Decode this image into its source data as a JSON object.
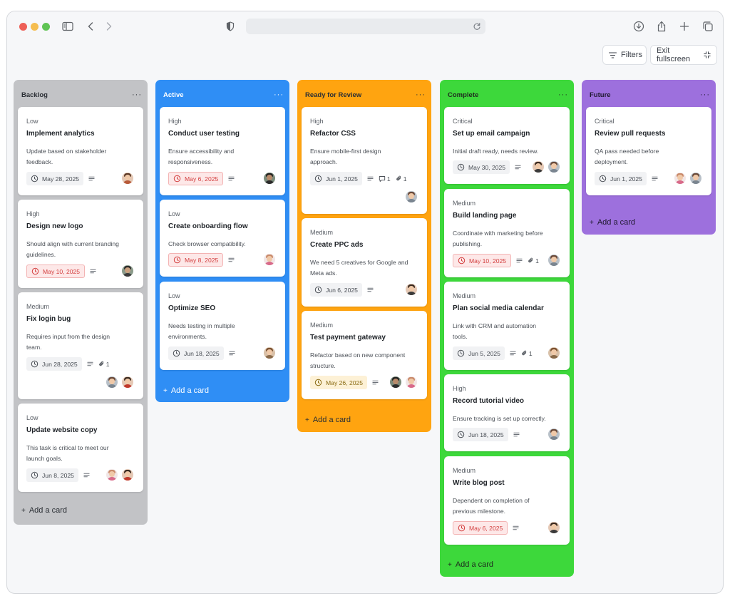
{
  "toolbar": {
    "filters_label": "Filters",
    "exit_fullscreen_label": "Exit fullscreen"
  },
  "add_card_label": "Add a card",
  "colors": {
    "backlog": "#c2c3c6",
    "active": "#2f8ef5",
    "ready_for_review": "#ffa410",
    "complete": "#3dd83b",
    "future": "#9d70dd"
  },
  "columns": [
    {
      "title": "Backlog",
      "cards": [
        {
          "priority": "Low",
          "title": "Implement analytics",
          "desc1": "Update based on stakeholder",
          "desc2": "feedback.",
          "date": "May 28, 2025"
        },
        {
          "priority": "High",
          "title": "Design new logo",
          "desc1": "Should align with current branding",
          "desc2": "guidelines.",
          "date": "May 10, 2025"
        },
        {
          "priority": "Medium",
          "title": "Fix login bug",
          "desc1": "Requires input from the design",
          "desc2": "team.",
          "date": "Jun 28, 2025",
          "attachments": "1"
        },
        {
          "priority": "Low",
          "title": "Update website copy",
          "desc1": "This task is critical to meet our",
          "desc2": "launch goals.",
          "date": "Jun 8, 2025"
        }
      ]
    },
    {
      "title": "Active",
      "cards": [
        {
          "priority": "High",
          "title": "Conduct user testing",
          "desc1": "Ensure accessibility and",
          "desc2": "responsiveness.",
          "date": "May 6, 2025"
        },
        {
          "priority": "Low",
          "title": "Create onboarding flow",
          "desc1": "Check browser compatibility.",
          "desc2": "",
          "date": "May 8, 2025"
        },
        {
          "priority": "Low",
          "title": "Optimize SEO",
          "desc1": "Needs testing in multiple",
          "desc2": "environments.",
          "date": "Jun 18, 2025"
        }
      ]
    },
    {
      "title": "Ready for Review",
      "cards": [
        {
          "priority": "High",
          "title": "Refactor CSS",
          "desc1": "Ensure mobile-first design",
          "desc2": "approach.",
          "date": "Jun 1, 2025",
          "comments": "1",
          "attachments": "1"
        },
        {
          "priority": "Medium",
          "title": "Create PPC ads",
          "desc1": "We need 5 creatives for Google and",
          "desc2": "Meta ads.",
          "date": "Jun 6, 2025"
        },
        {
          "priority": "Medium",
          "title": "Test payment gateway",
          "desc1": "Refactor based on new component",
          "desc2": "structure.",
          "date": "May 26, 2025"
        }
      ]
    },
    {
      "title": "Complete",
      "cards": [
        {
          "priority": "Critical",
          "title": "Set up email campaign",
          "desc1": "Initial draft ready, needs review.",
          "desc2": "",
          "date": "May 30, 2025"
        },
        {
          "priority": "Medium",
          "title": "Build landing page",
          "desc1": "Coordinate with marketing before",
          "desc2": "publishing.",
          "date": "May 10, 2025",
          "attachments": "1"
        },
        {
          "priority": "Medium",
          "title": "Plan social media calendar",
          "desc1": "Link with CRM and automation",
          "desc2": "tools.",
          "date": "Jun 5, 2025",
          "attachments": "1"
        },
        {
          "priority": "High",
          "title": "Record tutorial video",
          "desc1": "Ensure tracking is set up correctly.",
          "desc2": "",
          "date": "Jun 18, 2025"
        },
        {
          "priority": "Medium",
          "title": "Write blog post",
          "desc1": "Dependent on completion of",
          "desc2": "previous milestone.",
          "date": "May 6, 2025"
        }
      ]
    },
    {
      "title": "Future",
      "cards": [
        {
          "priority": "Critical",
          "title": "Review pull requests",
          "desc1": "QA pass needed before",
          "desc2": "deployment.",
          "date": "Jun 1, 2025"
        }
      ]
    }
  ]
}
